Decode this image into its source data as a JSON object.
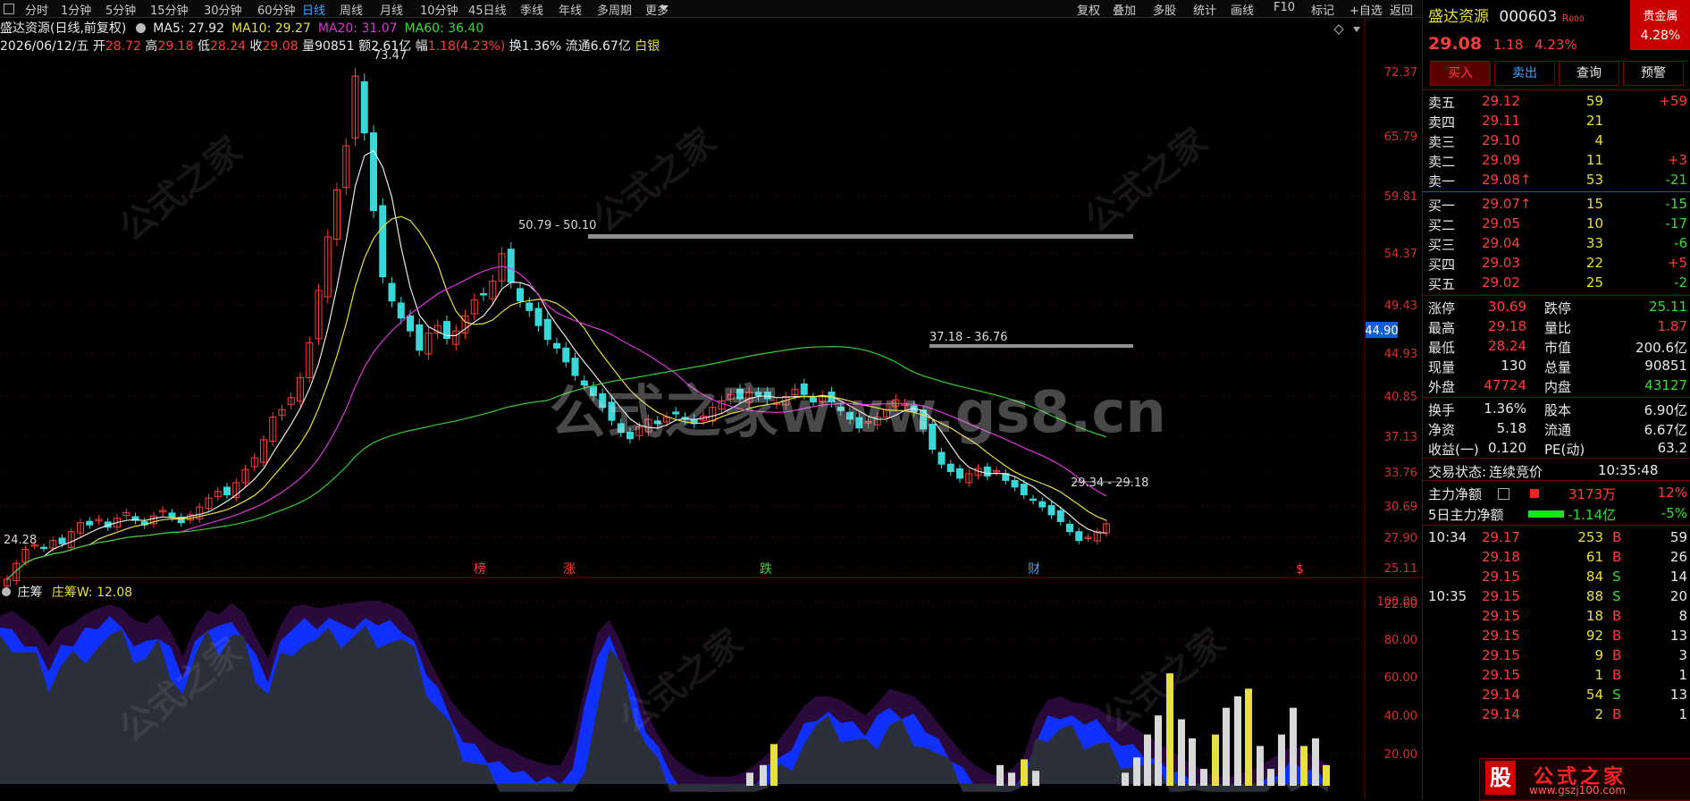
{
  "toolbar": {
    "periods": [
      "分时",
      "1分钟",
      "5分钟",
      "15分钟",
      "30分钟",
      "60分钟",
      "日线",
      "周线",
      "月线",
      "10分钟",
      "45日线",
      "季线",
      "年线",
      "多周期",
      "更多"
    ],
    "active_period": "日线",
    "right_buttons": [
      "复权",
      "叠加",
      "多股",
      "统计",
      "画线",
      "F10",
      "标记",
      "+自选",
      "返回"
    ]
  },
  "header": {
    "title": "盛达资源(日线,前复权)",
    "ma": [
      {
        "label": "MA5: 27.92",
        "color": "#e8e8e8"
      },
      {
        "label": "MA10: 29.27",
        "color": "#e8e040"
      },
      {
        "label": "MA20: 31.07",
        "color": "#dd33dd"
      },
      {
        "label": "MA60: 36.40",
        "color": "#33dd33"
      }
    ],
    "date": "2026/06/12/五",
    "open_label": "开",
    "open": "28.72",
    "high_label": "高",
    "high": "29.18",
    "low_label": "低",
    "low": "28.24",
    "close_label": "收",
    "close": "29.08",
    "vol_label": "量",
    "vol": "90851",
    "amt_label": "额",
    "amt": "2.61亿",
    "chg_label": "幅",
    "chg": "1.18(4.23%)",
    "turn": "换1.36%",
    "float": "流通6.67亿",
    "tag": "白银"
  },
  "chart_data": {
    "type": "candlestick",
    "price_axis": [
      "72.37",
      "65.79",
      "59.81",
      "54.37",
      "49.43",
      "44.93",
      "40.85",
      "37.13",
      "33.76",
      "30.69",
      "27.90",
      "25.11",
      "22.60"
    ],
    "current_price_tag": "44.90",
    "annotations": {
      "max": "73.47",
      "min": "24.28",
      "range1": "50.79 - 50.10",
      "range2": "37.18 - 36.76",
      "range3": "29.34 - 29.18"
    },
    "event_marks": [
      {
        "label": "榜",
        "color": "#ff3c3c"
      },
      {
        "label": "涨",
        "color": "#ff3c3c"
      },
      {
        "label": "跌",
        "color": "#33dd33"
      },
      {
        "label": "财",
        "color": "#3fa0ff"
      },
      {
        "label": "$",
        "color": "#ff3c3c"
      }
    ],
    "indicator": {
      "name": "庄筹",
      "label": "庄筹W: 12.08",
      "axis": [
        "100.00",
        "80.00",
        "60.00",
        "40.00",
        "20.00"
      ]
    }
  },
  "panel": {
    "name": "盛达资源",
    "code": "000603",
    "badge": "R",
    "badge2": "000",
    "side_tag": "贵金属",
    "side_pct": "4.28%",
    "price": "29.08",
    "change": "1.18",
    "pct": "4.23%",
    "buttons": [
      "买入",
      "卖出",
      "查询",
      "预警"
    ],
    "sells": [
      {
        "label": "卖五",
        "price": "29.12",
        "vol": "59",
        "delta": "+59"
      },
      {
        "label": "卖四",
        "price": "29.11",
        "vol": "21",
        "delta": ""
      },
      {
        "label": "卖三",
        "price": "29.10",
        "vol": "4",
        "delta": ""
      },
      {
        "label": "卖二",
        "price": "29.09",
        "vol": "11",
        "delta": "+3"
      },
      {
        "label": "卖一",
        "price": "29.08↑",
        "vol": "53",
        "delta": "-21"
      }
    ],
    "buys": [
      {
        "label": "买一",
        "price": "29.07↑",
        "vol": "15",
        "delta": "-15"
      },
      {
        "label": "买二",
        "price": "29.05",
        "vol": "10",
        "delta": "-17"
      },
      {
        "label": "买三",
        "price": "29.04",
        "vol": "33",
        "delta": "-6"
      },
      {
        "label": "买四",
        "price": "29.03",
        "vol": "22",
        "delta": "+5"
      },
      {
        "label": "买五",
        "price": "29.02",
        "vol": "25",
        "delta": "-2"
      }
    ],
    "stats": [
      {
        "l1": "涨停",
        "v1": "30.69",
        "c1": "r",
        "l2": "跌停",
        "v2": "25.11",
        "c2": "g"
      },
      {
        "l1": "最高",
        "v1": "29.18",
        "c1": "r",
        "l2": "量比",
        "v2": "1.87",
        "c2": "r"
      },
      {
        "l1": "最低",
        "v1": "28.24",
        "c1": "r",
        "l2": "市值",
        "v2": "200.6亿",
        "c2": "w"
      },
      {
        "l1": "现量",
        "v1": "130",
        "c1": "w",
        "l2": "总量",
        "v2": "90851",
        "c2": "w"
      },
      {
        "l1": "外盘",
        "v1": "47724",
        "c1": "r",
        "l2": "内盘",
        "v2": "43127",
        "c2": "g"
      }
    ],
    "stats2": [
      {
        "l1": "换手",
        "v1": "1.36%",
        "l2": "股本",
        "v2": "6.90亿"
      },
      {
        "l1": "净资",
        "v1": "5.18",
        "l2": "流通",
        "v2": "6.67亿"
      },
      {
        "l1": "收益(一)",
        "v1": "0.120",
        "l2": "PE(动)",
        "v2": "63.2"
      }
    ],
    "trade_state_label": "交易状态:",
    "trade_state": "连续竞价",
    "trade_time": "10:35:48",
    "main_net_label": "主力净额",
    "main_net": "3173万",
    "main_net_pct": "12%",
    "five_net_label": "5日主力净额",
    "five_net": "-1.14亿",
    "five_net_pct": "-5%",
    "ticks": [
      {
        "time": "10:34",
        "price": "29.17",
        "vol": "253",
        "bs": "B",
        "n": "59"
      },
      {
        "time": "",
        "price": "29.18",
        "vol": "61",
        "bs": "B",
        "n": "26"
      },
      {
        "time": "",
        "price": "29.15",
        "vol": "84",
        "bs": "S",
        "n": "14"
      },
      {
        "time": "10:35",
        "price": "29.15",
        "vol": "88",
        "bs": "S",
        "n": "20"
      },
      {
        "time": "",
        "price": "29.15",
        "vol": "18",
        "bs": "B",
        "n": "8"
      },
      {
        "time": "",
        "price": "29.15",
        "vol": "92",
        "bs": "B",
        "n": "13"
      },
      {
        "time": "",
        "price": "29.15",
        "vol": "9",
        "bs": "B",
        "n": "3"
      },
      {
        "time": "",
        "price": "29.15",
        "vol": "1",
        "bs": "B",
        "n": "1"
      },
      {
        "time": "",
        "price": "29.14",
        "vol": "54",
        "bs": "S",
        "n": "13"
      },
      {
        "time": "",
        "price": "29.14",
        "vol": "2",
        "bs": "B",
        "n": "1"
      }
    ],
    "logo_text": "公式之家",
    "logo_badge": "股",
    "logo_url": "www.gszj100.com"
  },
  "watermarks": {
    "center": "公式之家www.gs8.cn",
    "small": "公式之家",
    "url": "www.gs8.cn"
  }
}
